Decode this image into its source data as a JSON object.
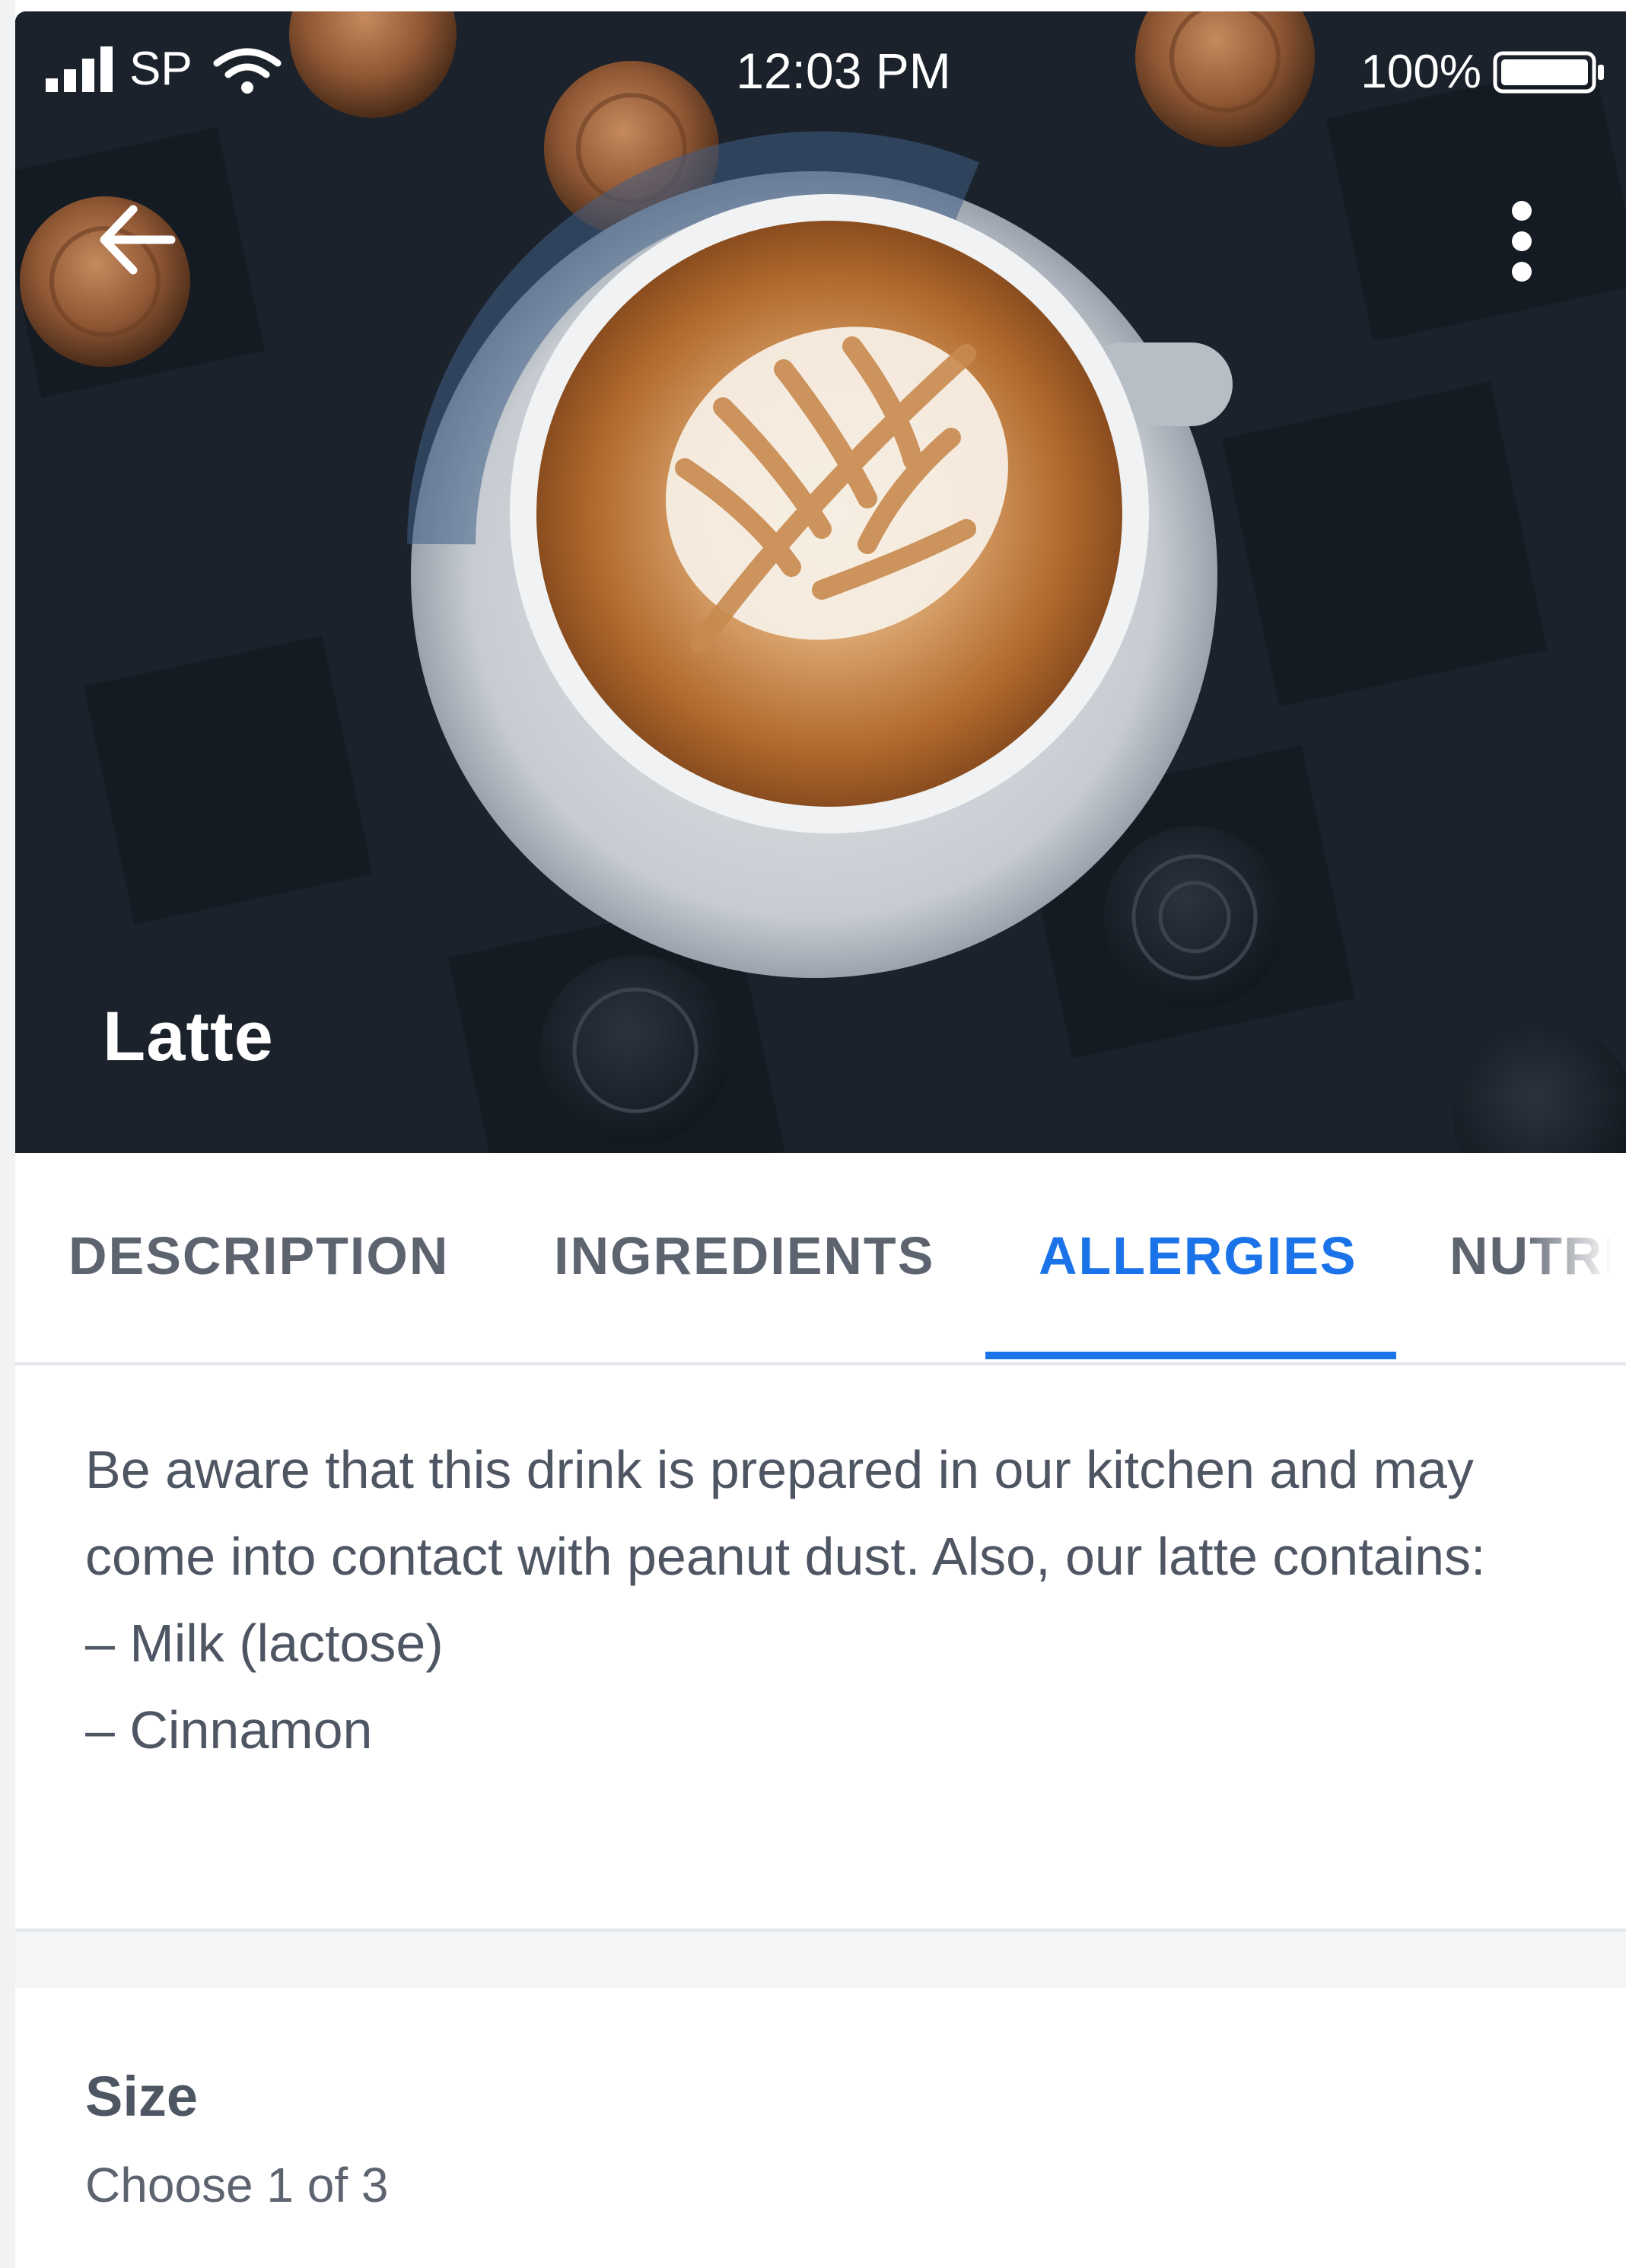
{
  "status_bar": {
    "carrier": "SP",
    "time": "12:03 PM",
    "battery": "100%",
    "icons": [
      "signal-bars-icon",
      "wifi-icon",
      "battery-icon"
    ]
  },
  "header": {
    "back_icon": "arrow-left-icon",
    "more_icon": "more-vertical-icon",
    "title": "Latte",
    "hero_image": "latte-art-cup-photo"
  },
  "tabs": [
    {
      "label": "DESCRIPTION",
      "active": false
    },
    {
      "label": "INGREDIENTS",
      "active": false
    },
    {
      "label": "ALLERGIES",
      "active": true
    },
    {
      "label": "NUTRI",
      "active": false
    }
  ],
  "allergies": {
    "text": "Be aware that this drink is prepared in our kitchen and may come into contact with peanut dust. Also, our latte contains:",
    "items": [
      "– Milk (lactose)",
      "– Cinnamon"
    ]
  },
  "size": {
    "title": "Size",
    "subtitle": "Choose 1 of 3"
  },
  "colors": {
    "accent": "#1a73e8",
    "text": "#4f5663",
    "tab_inactive": "#5d6470"
  }
}
